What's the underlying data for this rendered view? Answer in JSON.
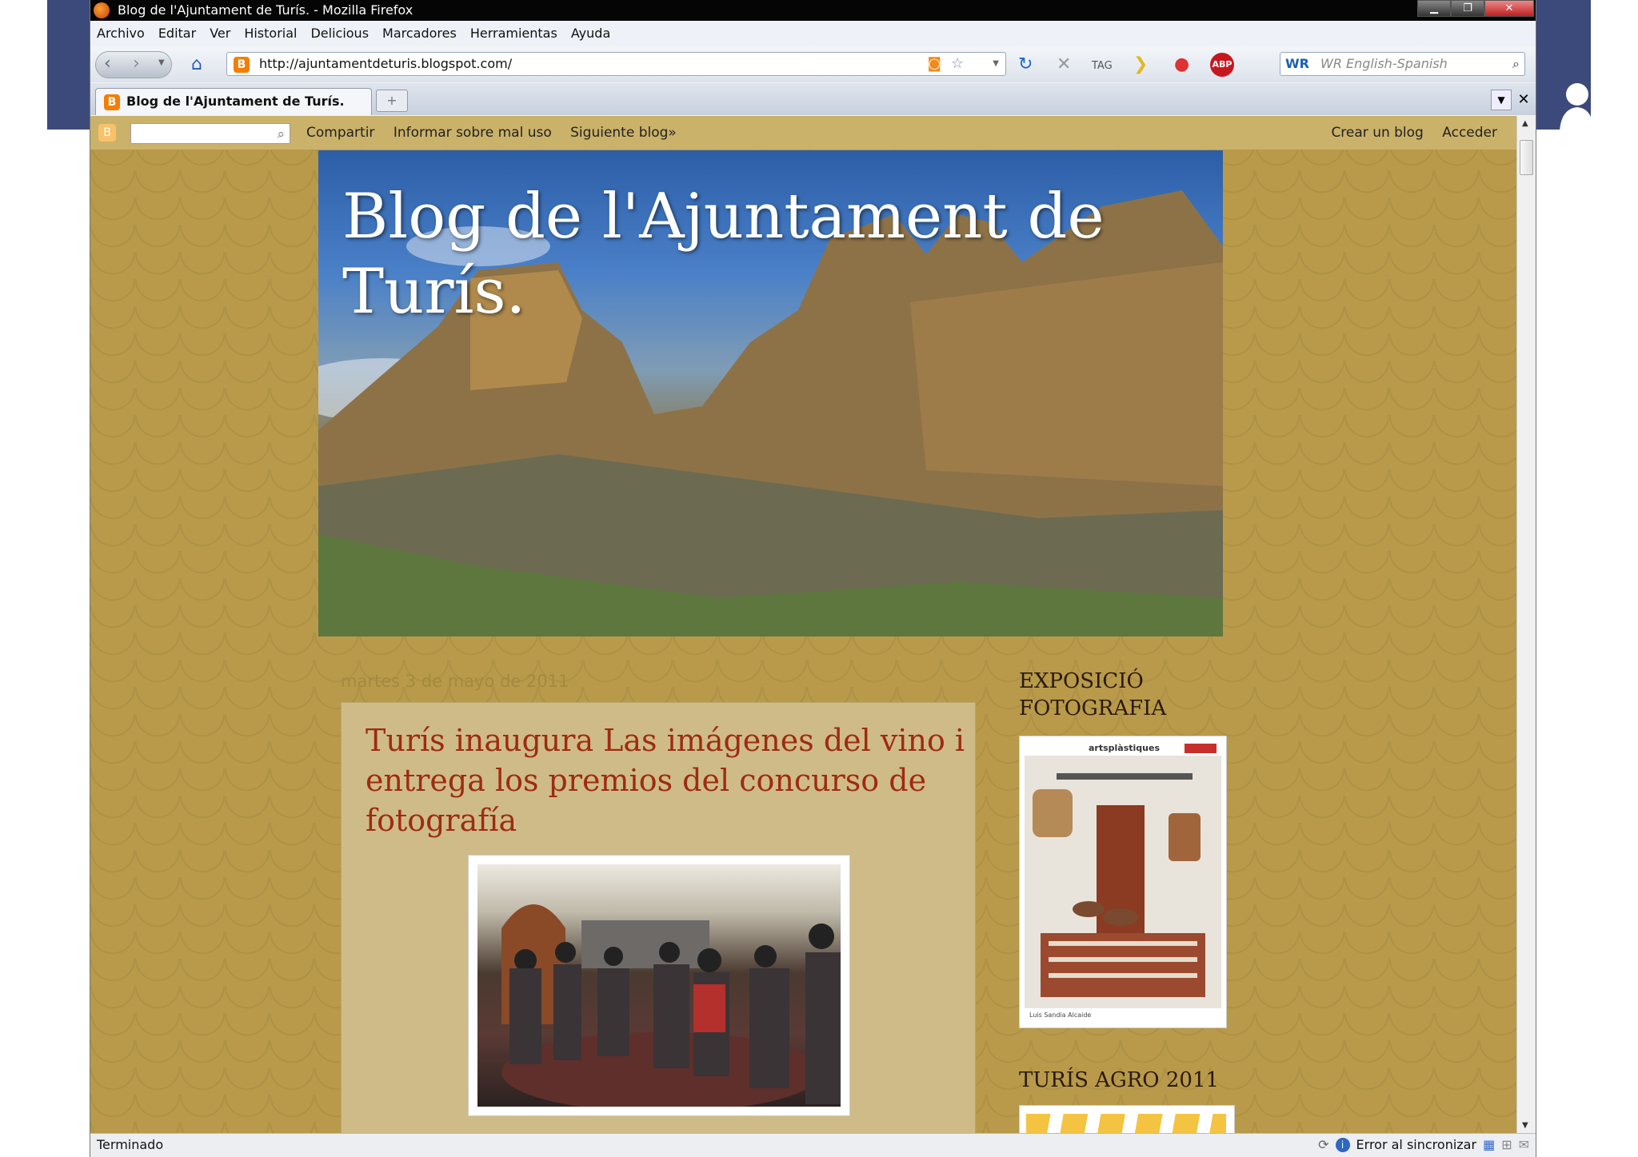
{
  "window": {
    "title": "Blog de l'Ajuntament de Turís. - Mozilla Firefox"
  },
  "menu": [
    "Archivo",
    "Editar",
    "Ver",
    "Historial",
    "Delicious",
    "Marcadores",
    "Herramientas",
    "Ayuda"
  ],
  "navbar": {
    "url": "http://ajuntamentdeturis.blogspot.com/",
    "search_placeholder": "WR English-Spanish"
  },
  "tabs": [
    {
      "label": "Blog de l'Ajuntament de Turís."
    }
  ],
  "blogger_bar": {
    "links": [
      "Compartir",
      "Informar sobre mal uso",
      "Siguiente blog»"
    ],
    "right_links": [
      "Crear un blog",
      "Acceder"
    ]
  },
  "blog": {
    "title": "Blog de l'Ajuntament de Turís.",
    "date_header": "martes 3 de mayo de 2011",
    "post_title": "Turís inaugura Las imágenes del vino i entrega los premios del concurso de fotografía"
  },
  "sidebar": {
    "widget1_title": "EXPOSICIÓ FOTOGRAFIA",
    "poster_header": "artsplàstiques",
    "poster_footer": "Luis Sandia Alcaide",
    "widget2_title": "TURÍS AGRO 2011"
  },
  "status": {
    "left": "Terminado",
    "sync": "Error al sincronizar"
  },
  "colors": {
    "page_bg": "#b89a4a",
    "post_bg": "#cfbb87",
    "post_title": "#9e2b12",
    "titlebar": "#050505"
  }
}
